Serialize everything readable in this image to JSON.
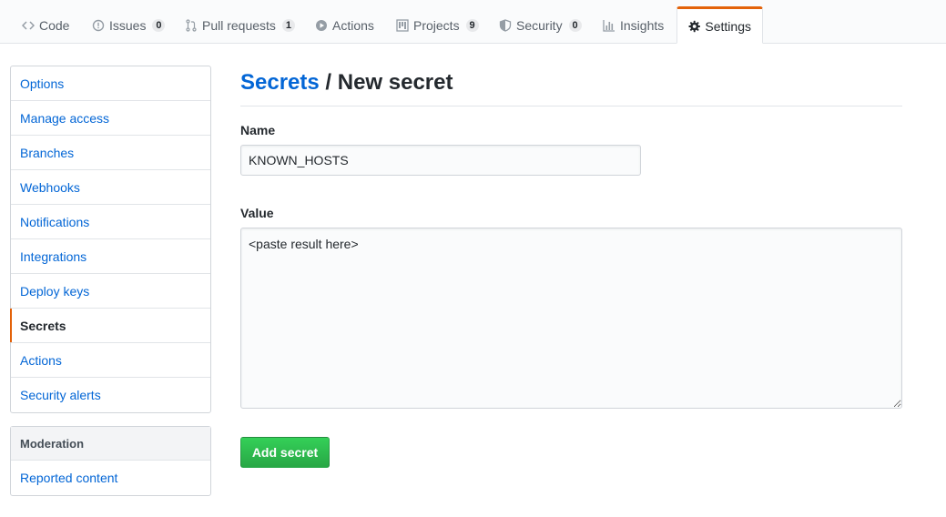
{
  "tabs": [
    {
      "label": "Code",
      "icon": "code-icon"
    },
    {
      "label": "Issues",
      "icon": "issue-opened-icon",
      "count": "0"
    },
    {
      "label": "Pull requests",
      "icon": "git-pull-request-icon",
      "count": "1"
    },
    {
      "label": "Actions",
      "icon": "play-icon"
    },
    {
      "label": "Projects",
      "icon": "project-icon",
      "count": "9"
    },
    {
      "label": "Security",
      "icon": "shield-icon",
      "count": "0"
    },
    {
      "label": "Insights",
      "icon": "graph-icon"
    },
    {
      "label": "Settings",
      "icon": "gear-icon",
      "selected": true
    }
  ],
  "sidebar": {
    "items": [
      {
        "label": "Options"
      },
      {
        "label": "Manage access"
      },
      {
        "label": "Branches"
      },
      {
        "label": "Webhooks"
      },
      {
        "label": "Notifications"
      },
      {
        "label": "Integrations"
      },
      {
        "label": "Deploy keys"
      },
      {
        "label": "Secrets",
        "selected": true
      },
      {
        "label": "Actions"
      },
      {
        "label": "Security alerts"
      }
    ],
    "moderation": {
      "heading": "Moderation",
      "items": [
        {
          "label": "Reported content"
        }
      ]
    }
  },
  "main": {
    "breadcrumb_link": "Secrets",
    "breadcrumb_sep": " / ",
    "title": "New secret",
    "name_label": "Name",
    "name_value": "KNOWN_HOSTS",
    "value_label": "Value",
    "value_value": "<paste result here>",
    "submit_label": "Add secret"
  },
  "colors": {
    "link": "#0366d6",
    "selected_accent": "#e36209",
    "button_green": "#28a745"
  }
}
